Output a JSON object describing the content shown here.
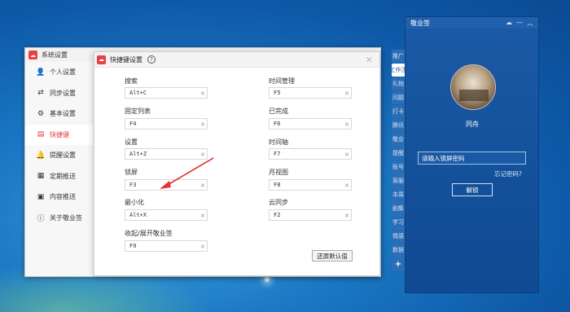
{
  "settings_window": {
    "title": "系统设置",
    "sidebar": [
      {
        "label": "个人设置",
        "icon": "user-icon"
      },
      {
        "label": "同步设置",
        "icon": "sync-icon"
      },
      {
        "label": "基本设置",
        "icon": "gear-icon"
      },
      {
        "label": "快捷键",
        "icon": "keyboard-icon",
        "active": true
      },
      {
        "label": "提醒设置",
        "icon": "bell-icon"
      },
      {
        "label": "定期推送",
        "icon": "schedule-icon"
      },
      {
        "label": "内容推送",
        "icon": "document-icon"
      },
      {
        "label": "关于敬业签",
        "icon": "info-icon"
      }
    ]
  },
  "hotkey_window": {
    "title": "快捷键设置",
    "fields": [
      {
        "label": "搜索",
        "value": "Alt+C"
      },
      {
        "label": "时间管理",
        "value": "F5"
      },
      {
        "label": "固定列表",
        "value": "F4"
      },
      {
        "label": "已完成",
        "value": "F6"
      },
      {
        "label": "设置",
        "value": "Alt+Z"
      },
      {
        "label": "时间轴",
        "value": "F7"
      },
      {
        "label": "锁屏",
        "value": "F3"
      },
      {
        "label": "月视图",
        "value": "F8"
      },
      {
        "label": "最小化",
        "value": "Alt+X"
      },
      {
        "label": "云同步",
        "value": "F2"
      },
      {
        "label": "收起/展开敬业签",
        "value": "F9"
      }
    ],
    "restore_label": "还原默认值"
  },
  "note_panel": {
    "title": "敬业签",
    "tabs": [
      "推广",
      "工作注",
      "礼物",
      "问题",
      "打卡",
      "腾讯",
      "敬业",
      "提醒",
      "账号",
      "客服",
      "本周",
      "剧集",
      "学习",
      "情感",
      "数据"
    ],
    "active_tab": 1,
    "plus_label": "+",
    "username": "同舟",
    "password_placeholder": "请输入锁屏密码",
    "forgot_label": "忘记密码?",
    "unlock_label": "解锁"
  },
  "colors": {
    "accent": "#e04040",
    "panel_blue": "#1b5aa6",
    "arrow_red": "#e53333"
  }
}
